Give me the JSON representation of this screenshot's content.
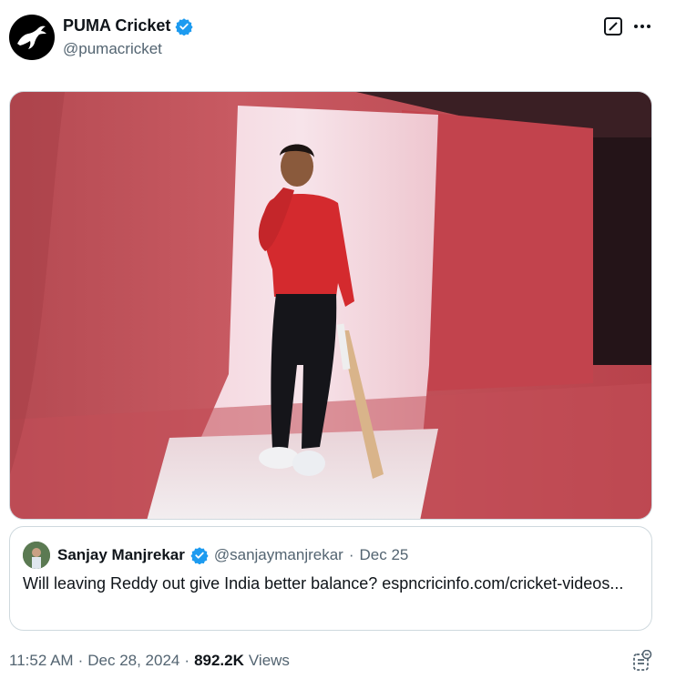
{
  "post": {
    "author": {
      "display_name": "PUMA Cricket",
      "handle": "@pumacricket",
      "verified": true,
      "avatar_icon": "puma-logo-icon"
    },
    "media": {
      "type": "photo",
      "description_icon": "photo"
    },
    "quoted_post": {
      "author": {
        "display_name": "Sanjay Manjrekar",
        "handle": "@sanjaymanjrekar",
        "verified": true
      },
      "separator": "·",
      "date": "Dec 25",
      "text": "Will leaving Reddy out give India better balance? espncricinfo.com/cricket-videos..."
    },
    "meta": {
      "time": "11:52 AM",
      "separator": "·",
      "date": "Dec 28, 2024",
      "views_count": "892.2K",
      "views_label": "Views"
    }
  },
  "colors": {
    "verified_blue": "#1d9bf0",
    "secondary_text": "#536471",
    "primary_text": "#0f1419",
    "border": "#cfd9de"
  }
}
